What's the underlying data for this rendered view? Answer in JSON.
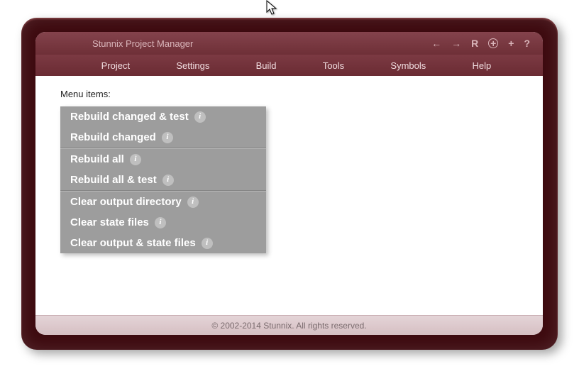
{
  "header": {
    "title": "Stunnix Project Manager",
    "icons": {
      "back": "←",
      "forward": "→",
      "reload": "R",
      "add_circle": "+",
      "add": "+",
      "help": "?"
    }
  },
  "menubar": {
    "items": [
      "Project",
      "Settings",
      "Build",
      "Tools",
      "Symbols",
      "Help"
    ]
  },
  "content": {
    "heading": "Menu items:",
    "groups": [
      {
        "items": [
          "Rebuild changed & test",
          "Rebuild changed"
        ]
      },
      {
        "items": [
          "Rebuild all",
          "Rebuild all & test"
        ]
      },
      {
        "items": [
          "Clear output directory",
          "Clear state files",
          "Clear output & state files"
        ]
      }
    ]
  },
  "footer": {
    "text": "© 2002-2014 Stunnix. All rights reserved."
  }
}
